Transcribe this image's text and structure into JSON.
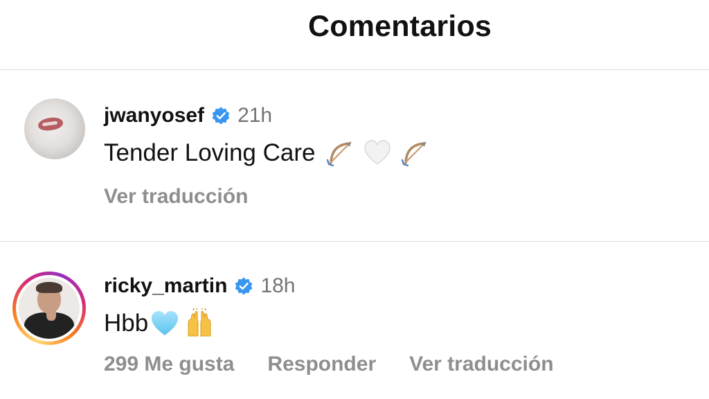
{
  "header": {
    "title": "Comentarios"
  },
  "comments": [
    {
      "username": "jwanyosef",
      "verified": true,
      "time": "21h",
      "text": "Tender Loving Care",
      "emojis": [
        "bow-and-arrow-icon",
        "white-heart-icon",
        "bow-and-arrow-icon"
      ],
      "actions": {
        "translate": "Ver traducción"
      }
    },
    {
      "username": "ricky_martin",
      "verified": true,
      "time": "18h",
      "text": "Hbb",
      "emojis": [
        "light-blue-heart-icon",
        "raising-hands-icon"
      ],
      "actions": {
        "likes": "299 Me gusta",
        "reply": "Responder",
        "translate": "Ver traducción"
      }
    }
  ],
  "colors": {
    "verified": "#3897f0",
    "secondary_text": "#8e8e8e",
    "divider": "#dbdbdb"
  }
}
